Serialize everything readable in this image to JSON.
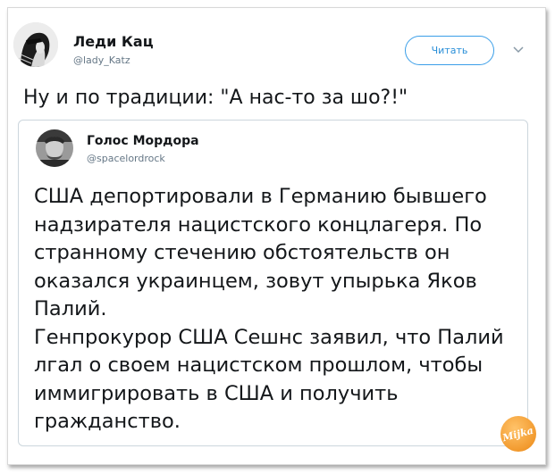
{
  "tweet": {
    "author": {
      "name": "Леди Кац",
      "handle": "@lady_Katz",
      "avatar": "woman-portrait-avatar"
    },
    "follow_label": "Читать",
    "menu_icon": "chevron-down-icon",
    "text": "Ну и по традиции: \"А нас-то за шо?!\""
  },
  "quote": {
    "author": {
      "name": "Голос Мордора",
      "handle": "@spacelordrock",
      "avatar": "man-portrait-avatar"
    },
    "paragraphs": [
      "США депортировали в Германию бывшего надзирателя нацистского концлагеря. По странному стечению обстоятельств он оказался украинцем, зовут упырька Яков Палий.",
      "Генпрокурор США Сешнс заявил, что Палий лгал о своем нацистском прошлом, чтобы иммигрировать в США и получить гражданство."
    ]
  },
  "watermark": {
    "text": "Mijka",
    "color": "#f29a2e"
  },
  "colors": {
    "accent": "#1da1f2",
    "text": "#14171a",
    "muted": "#657786",
    "border": "#ccd6dd"
  }
}
